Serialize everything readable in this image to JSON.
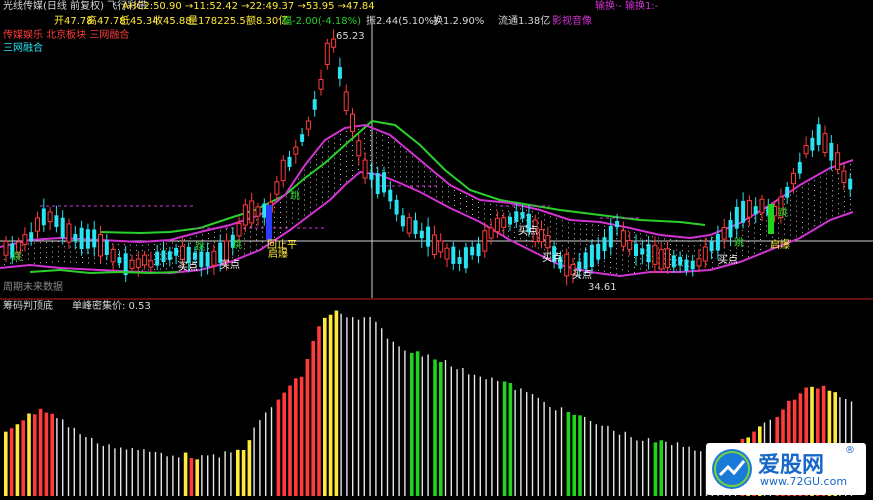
{
  "header": {
    "title": "光线传媒(日线 前复权) 飞行彩带",
    "ahc": "AHC2:50.90 →11:52.42 →22:49.37 →53.95 →47.84",
    "top_right": "输换·- 输换1:-"
  },
  "quote": {
    "open": "开47.78",
    "high": "高47.78",
    "low": "低45.34",
    "close": "收45.88",
    "volume": "量178225.5",
    "amount": "额8.30亿",
    "change": "幅-2.00(-4.18%)",
    "amplitude": "振2.44(5.10%)",
    "turnover": "换1.2.90%",
    "float": "流通1.38亿",
    "concept": "影视音像"
  },
  "tags": {
    "sector": "传媒娱乐 北京板块 三网融合",
    "concept2": "三网融合"
  },
  "annotations": {
    "high_price": "65.23",
    "low_price": "34.61",
    "buy_point": "买点",
    "jump": "跳",
    "launch": "启爆",
    "stop_loss": "回止平",
    "future_label": "周期未来数据"
  },
  "indicator": {
    "name": "筹码判顶底",
    "avg_cost": "单峰密集价: 0.53"
  },
  "watermark": {
    "name": "爱股网",
    "url": "www.72GU.com",
    "reg": "®"
  },
  "colors": {
    "up": "#ff3b3b",
    "down": "#29e3f2",
    "band": "#d233d2",
    "green_band": "#2ad02a",
    "yellow": "#ffe93a",
    "white": "#e6e6e6",
    "green_bar": "#1fd31f"
  },
  "chart_data": {
    "type": "candlestick",
    "price_levels": [
      65.23,
      34.61
    ]
  }
}
